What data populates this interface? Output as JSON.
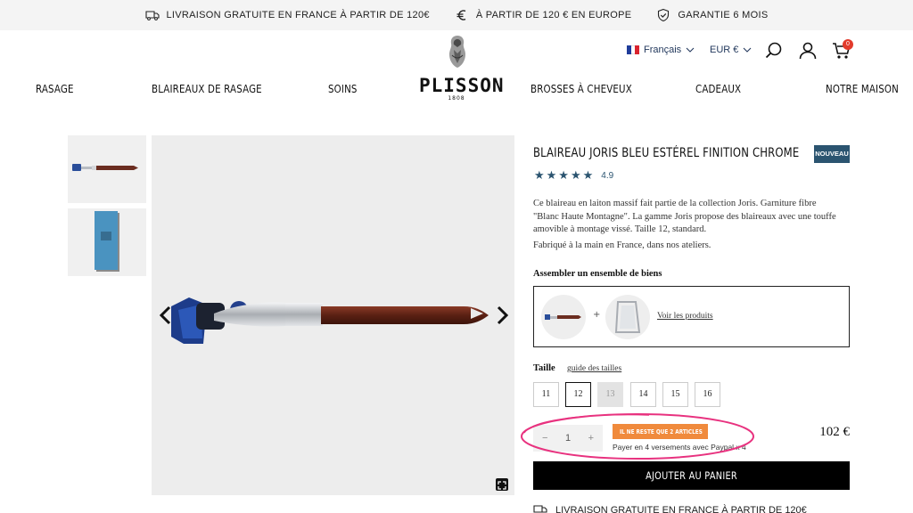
{
  "topbar": {
    "free_delivery": "LIVRAISON GRATUITE EN FRANCE À PARTIR DE 120€",
    "europe": "À PARTIR DE 120 € EN EUROPE",
    "warranty": "GARANTIE 6 MOIS"
  },
  "header": {
    "logo_text": "PLISSON",
    "logo_year": "1808",
    "language": "Français",
    "currency": "EUR €",
    "cart_count": "0",
    "nav": [
      "RASAGE",
      "BLAIREAUX DE RASAGE",
      "SOINS",
      "BROSSES À CHEVEUX",
      "CADEAUX",
      "NOTRE MAISON"
    ]
  },
  "product": {
    "title": "BLAIREAU JORIS BLEU ESTÉREL FINITION CHROME",
    "badge": "NOUVEAU",
    "stars": "★★★★★",
    "rating": "4.9",
    "description": "Ce blaireau en laiton massif fait partie de la collection Joris. Garniture fibre \"Blanc Haute Montagne\". La gamme Joris propose des blaireaux avec une touffe amovible à montage vissé. Taille 12, standard.",
    "made_in": "Fabriqué à la main en France, dans nos ateliers.",
    "bundle_title": "Assembler un ensemble de biens",
    "bundle_plus": "+",
    "bundle_link": "Voir les produits",
    "size_label": "Taille",
    "size_guide": "guide des tailles",
    "sizes": [
      "11",
      "12",
      "13",
      "14",
      "15",
      "16"
    ],
    "selected_size": "12",
    "unavailable_size": "13",
    "qty_minus": "−",
    "qty": "1",
    "qty_plus": "+",
    "stock_alert": "IL NE RESTE QUE 2 ARTICLES",
    "paypal": "Payer en 4 versements avec Paypal x 4",
    "price": "102 €",
    "add_to_cart": "AJOUTER AU PANIER",
    "shipping_note": "LIVRAISON GRATUITE EN FRANCE À PARTIR DE 120€"
  },
  "colors": {
    "accent": "#2b5470",
    "stock": "#f08a3c",
    "highlight": "#e8327f",
    "cart_badge": "#e23b2c"
  }
}
